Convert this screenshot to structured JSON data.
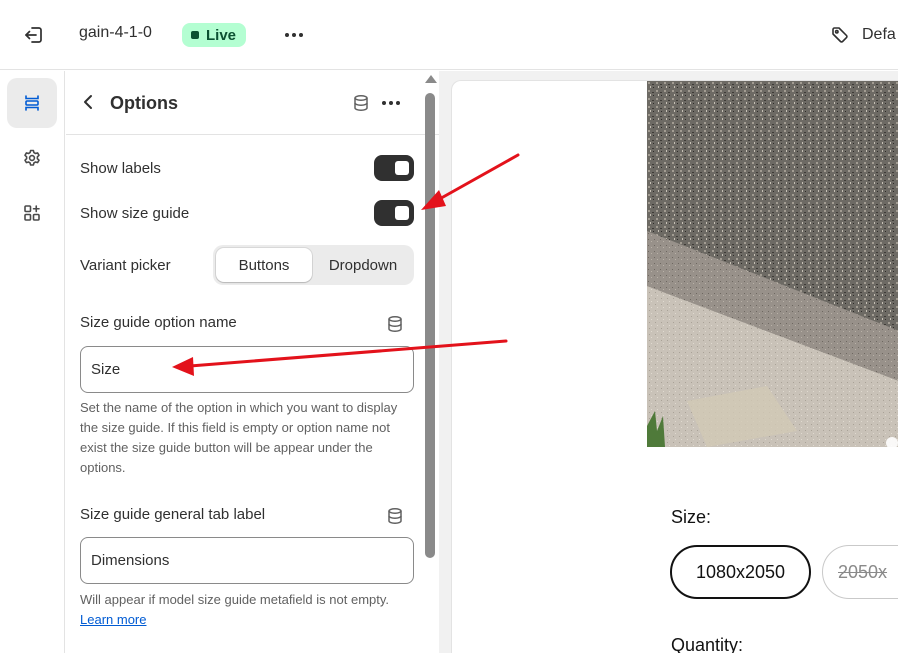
{
  "topbar": {
    "theme_name": "gain-4-1-0",
    "live_badge": "Live",
    "default_label": "Defa"
  },
  "rail": {
    "items": [
      {
        "icon": "sections-icon",
        "active": true
      },
      {
        "icon": "gear-icon",
        "active": false
      },
      {
        "icon": "apps-add-icon",
        "active": false
      }
    ]
  },
  "panel": {
    "title": "Options",
    "show_labels": {
      "label": "Show labels",
      "checked": true
    },
    "show_size_guide": {
      "label": "Show size guide",
      "checked": true
    },
    "variant_picker": {
      "label": "Variant picker",
      "options": [
        "Buttons",
        "Dropdown"
      ],
      "selected": "Buttons"
    },
    "size_guide_option_name": {
      "label": "Size guide option name",
      "value": "Size",
      "help": "Set the name of the option in which you want to display the size guide. If this field is empty or option name not exist the size guide button will be appear under the options."
    },
    "size_guide_general_tab_label": {
      "label": "Size guide general tab label",
      "value": "Dimensions",
      "help": "Will appear if model size guide metafield is not empty.",
      "help_link": "Learn more"
    }
  },
  "preview": {
    "size_label": "Size:",
    "sizes": [
      "1080x2050",
      "2050x"
    ],
    "selected_size": "1080x2050",
    "quantity_label": "Quantity:"
  },
  "colors": {
    "live_badge_bg": "#b4fed2",
    "toggle_on": "#303030",
    "annotation_arrow": "#e3121b",
    "link": "#005bd3"
  }
}
